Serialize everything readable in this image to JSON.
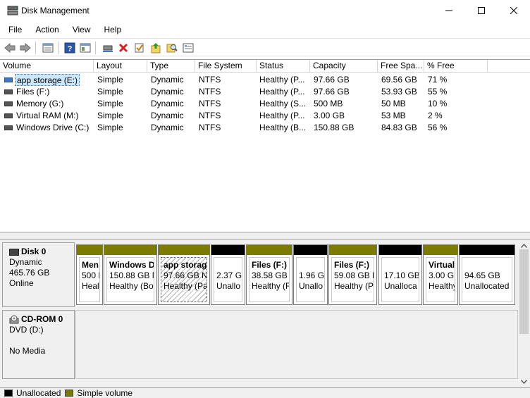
{
  "window": {
    "title": "Disk Management"
  },
  "menu": {
    "items": [
      {
        "label": "File"
      },
      {
        "label": "Action"
      },
      {
        "label": "View"
      },
      {
        "label": "Help"
      }
    ]
  },
  "toolbar": {
    "buttons": [
      {
        "icon": "back-arrow-icon"
      },
      {
        "icon": "forward-arrow-icon"
      },
      {
        "icon": "list-view-icon"
      },
      {
        "icon": "help-icon"
      },
      {
        "icon": "properties-view-icon"
      },
      {
        "icon": "connect-icon"
      },
      {
        "icon": "delete-icon"
      },
      {
        "icon": "check-icon"
      },
      {
        "icon": "import-icon"
      },
      {
        "icon": "search-icon"
      },
      {
        "icon": "settings-icon"
      }
    ]
  },
  "volume_list": {
    "columns": [
      "Volume",
      "Layout",
      "Type",
      "File System",
      "Status",
      "Capacity",
      "Free Spa...",
      "% Free"
    ],
    "rows": [
      {
        "volume": "app storage (E:)",
        "layout": "Simple",
        "type": "Dynamic",
        "fs": "NTFS",
        "status": "Healthy (P...",
        "capacity": "97.66 GB",
        "free": "69.56 GB",
        "pct": "71 %",
        "selected": true
      },
      {
        "volume": "Files (F:)",
        "layout": "Simple",
        "type": "Dynamic",
        "fs": "NTFS",
        "status": "Healthy (P...",
        "capacity": "97.66 GB",
        "free": "53.93 GB",
        "pct": "55 %",
        "selected": false
      },
      {
        "volume": "Memory (G:)",
        "layout": "Simple",
        "type": "Dynamic",
        "fs": "NTFS",
        "status": "Healthy (S...",
        "capacity": "500 MB",
        "free": "50 MB",
        "pct": "10 %",
        "selected": false
      },
      {
        "volume": "Virtual RAM (M:)",
        "layout": "Simple",
        "type": "Dynamic",
        "fs": "NTFS",
        "status": "Healthy (P...",
        "capacity": "3.00 GB",
        "free": "53 MB",
        "pct": "2 %",
        "selected": false
      },
      {
        "volume": "Windows Drive  (C:)",
        "layout": "Simple",
        "type": "Dynamic",
        "fs": "NTFS",
        "status": "Healthy (B...",
        "capacity": "150.88 GB",
        "free": "84.83 GB",
        "pct": "56 %",
        "selected": false
      }
    ]
  },
  "disks": [
    {
      "name": "Disk 0",
      "kind": "Dynamic",
      "size": "465.76 GB",
      "state": "Online",
      "partitions": [
        {
          "kind": "simple",
          "name": "Men",
          "size": "500 M",
          "status": "Heal",
          "hatched": false
        },
        {
          "kind": "simple",
          "name": "Windows D",
          "size": "150.88 GB N",
          "status": "Healthy (Bo",
          "hatched": false
        },
        {
          "kind": "simple",
          "name": "app storag",
          "size": "97.66 GB N",
          "status": "Healthy (Pa",
          "hatched": true
        },
        {
          "kind": "unalloc",
          "name": "",
          "size": "2.37 GI",
          "status": "Unallo",
          "hatched": false
        },
        {
          "kind": "simple",
          "name": "Files  (F:)",
          "size": "38.58 GB N",
          "status": "Healthy (F",
          "hatched": false
        },
        {
          "kind": "unalloc",
          "name": "",
          "size": "1.96 G",
          "status": "Unallo",
          "hatched": false
        },
        {
          "kind": "simple",
          "name": "Files  (F:)",
          "size": "59.08 GB N",
          "status": "Healthy (P",
          "hatched": false
        },
        {
          "kind": "unalloc",
          "name": "",
          "size": "17.10 GB",
          "status": "Unalloca",
          "hatched": false
        },
        {
          "kind": "simple",
          "name": "Virtual",
          "size": "3.00 GE",
          "status": "Healthy",
          "hatched": false
        },
        {
          "kind": "unalloc",
          "name": "",
          "size": "94.65 GB",
          "status": "Unallocated",
          "hatched": false
        }
      ]
    },
    {
      "name": "CD-ROM 0",
      "kind": "DVD (D:)",
      "size": "",
      "state": "No Media"
    }
  ],
  "legend": {
    "items": [
      {
        "label": "Unallocated",
        "color": "#000000"
      },
      {
        "label": "Simple volume",
        "color": "#7b7b00"
      }
    ]
  },
  "colors": {
    "simple": "#7b7b00",
    "unallocated": "#000000",
    "selection": "#cce8ff"
  }
}
